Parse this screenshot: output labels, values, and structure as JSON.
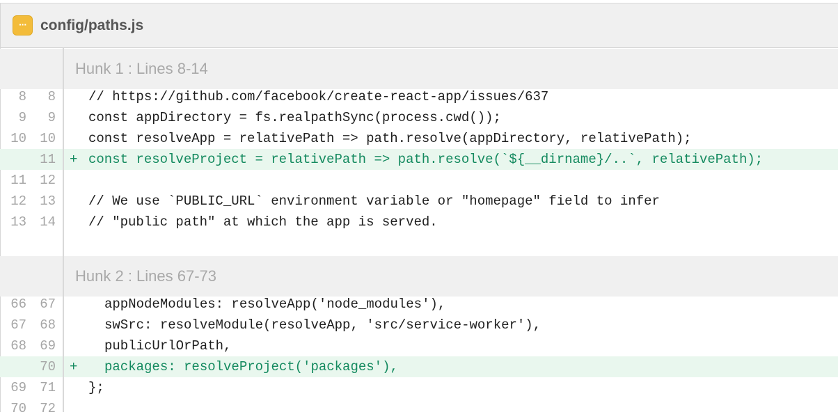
{
  "file": {
    "icon": "more-dots-icon",
    "icon_glyph": "···",
    "name": "config/paths.js",
    "icon_color": "#f3bc3a"
  },
  "hunks": [
    {
      "title": "Hunk 1 : Lines 8-14",
      "rows": [
        {
          "old": "8",
          "new": "8",
          "sign": "",
          "code": "// https://github.com/facebook/create-react-app/issues/637"
        },
        {
          "old": "9",
          "new": "9",
          "sign": "",
          "code": "const appDirectory = fs.realpathSync(process.cwd());"
        },
        {
          "old": "10",
          "new": "10",
          "sign": "",
          "code": "const resolveApp = relativePath => path.resolve(appDirectory, relativePath);"
        },
        {
          "old": "",
          "new": "11",
          "sign": "+",
          "code": "const resolveProject = relativePath => path.resolve(`${__dirname}/..`, relativePath);"
        },
        {
          "old": "11",
          "new": "12",
          "sign": "",
          "code": ""
        },
        {
          "old": "12",
          "new": "13",
          "sign": "",
          "code": "// We use `PUBLIC_URL` environment variable or \"homepage\" field to infer"
        },
        {
          "old": "13",
          "new": "14",
          "sign": "",
          "code": "// \"public path\" at which the app is served."
        }
      ]
    },
    {
      "title": "Hunk 2 : Lines 67-73",
      "rows": [
        {
          "old": "66",
          "new": "67",
          "sign": "",
          "code": "appNodeModules: resolveApp('node_modules'),"
        },
        {
          "old": "67",
          "new": "68",
          "sign": "",
          "code": "swSrc: resolveModule(resolveApp, 'src/service-worker'),"
        },
        {
          "old": "68",
          "new": "69",
          "sign": "",
          "code": "publicUrlOrPath,"
        },
        {
          "old": "",
          "new": "70",
          "sign": "+",
          "code": "packages: resolveProject('packages'),"
        },
        {
          "old": "69",
          "new": "71",
          "sign": "",
          "code": "};"
        },
        {
          "old": "70",
          "new": "72",
          "sign": "",
          "code": ""
        }
      ]
    }
  ],
  "colors": {
    "added_bg": "#e9f7ee",
    "added_text": "#148a5f",
    "hunk_bg": "#f0f0f0",
    "line_number": "#a6a6a6"
  }
}
